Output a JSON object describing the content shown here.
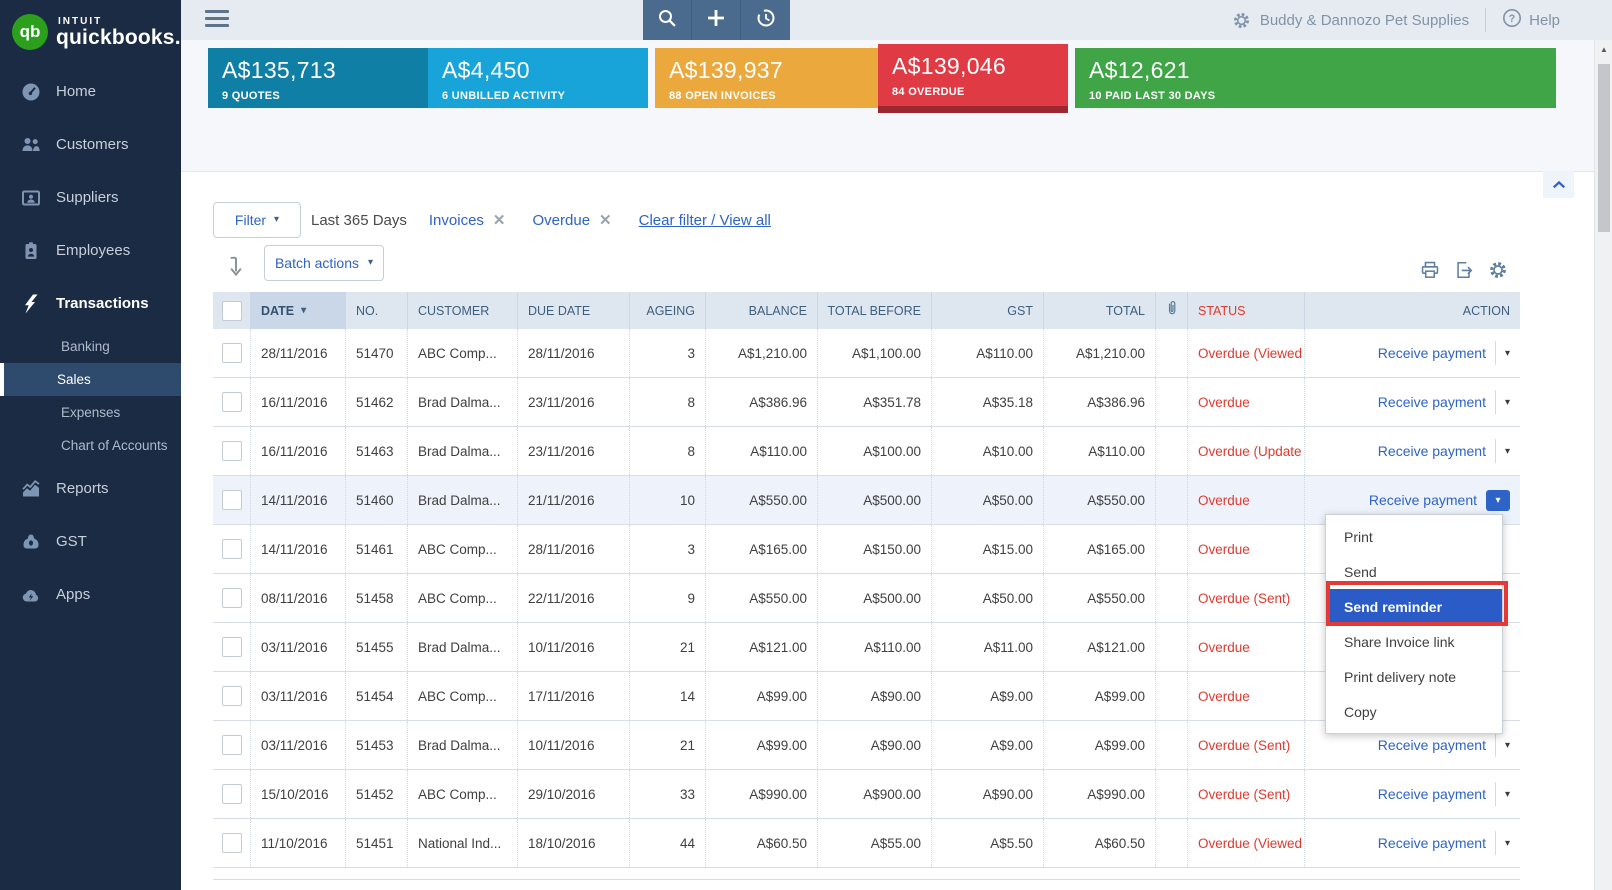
{
  "brand": {
    "intuit": "INTUIT",
    "name": "quickbooks.",
    "monogram": "qb"
  },
  "topbar": {
    "company": "Buddy & Dannozo Pet Supplies",
    "help_label": "Help"
  },
  "sidebar": {
    "items": [
      {
        "label": "Home",
        "icon": "gauge-icon",
        "active": false
      },
      {
        "label": "Customers",
        "icon": "customers-icon",
        "active": false
      },
      {
        "label": "Suppliers",
        "icon": "suppliers-icon",
        "active": false
      },
      {
        "label": "Employees",
        "icon": "employees-icon",
        "active": false
      },
      {
        "label": "Transactions",
        "icon": "transactions-icon",
        "active": true,
        "children": [
          {
            "label": "Banking",
            "active": false
          },
          {
            "label": "Sales",
            "active": true
          },
          {
            "label": "Expenses",
            "active": false
          },
          {
            "label": "Chart of Accounts",
            "active": false
          }
        ]
      },
      {
        "label": "Reports",
        "icon": "reports-icon",
        "active": false
      },
      {
        "label": "GST",
        "icon": "gst-icon",
        "active": false
      },
      {
        "label": "Apps",
        "icon": "apps-icon",
        "active": false
      }
    ]
  },
  "money_bar": [
    {
      "amount": "A$135,713",
      "label": "9 QUOTES",
      "color": "#0F7FA5",
      "raised": false
    },
    {
      "amount": "A$4,450",
      "label": "6 UNBILLED ACTIVITY",
      "color": "#18A4D9",
      "raised": false
    },
    {
      "amount": "A$139,937",
      "label": "88 OPEN INVOICES",
      "color": "#EBA83C",
      "raised": false
    },
    {
      "amount": "A$139,046",
      "label": "84 OVERDUE",
      "color": "#E03B44",
      "accent": "#9C2730",
      "raised": true
    },
    {
      "amount": "A$12,621",
      "label": "10 PAID LAST 30 DAYS",
      "color": "#3FA546",
      "raised": false
    }
  ],
  "filter_bar": {
    "filter_label": "Filter",
    "range": "Last 365 Days",
    "chips": [
      "Invoices",
      "Overdue"
    ],
    "clear_link": "Clear filter / View all",
    "batch_label": "Batch actions"
  },
  "table": {
    "columns": [
      "DATE",
      "NO.",
      "CUSTOMER",
      "DUE DATE",
      "AGEING",
      "BALANCE",
      "TOTAL BEFORE",
      "GST",
      "TOTAL",
      "STATUS",
      "ACTION"
    ],
    "sorted_column": "DATE",
    "action_label": "Receive payment",
    "rows": [
      {
        "date": "28/11/2016",
        "no": "51470",
        "customer": "ABC Comp...",
        "due": "28/11/2016",
        "ageing": "3",
        "balance": "A$1,210.00",
        "before": "A$1,100.00",
        "gst": "A$110.00",
        "total": "A$1,210.00",
        "status": "Overdue (Viewed",
        "action": true,
        "open": false
      },
      {
        "date": "16/11/2016",
        "no": "51462",
        "customer": "Brad Dalma...",
        "due": "23/11/2016",
        "ageing": "8",
        "balance": "A$386.96",
        "before": "A$351.78",
        "gst": "A$35.18",
        "total": "A$386.96",
        "status": "Overdue",
        "action": true,
        "open": false
      },
      {
        "date": "16/11/2016",
        "no": "51463",
        "customer": "Brad Dalma...",
        "due": "23/11/2016",
        "ageing": "8",
        "balance": "A$110.00",
        "before": "A$100.00",
        "gst": "A$10.00",
        "total": "A$110.00",
        "status": "Overdue (Update",
        "action": true,
        "open": false
      },
      {
        "date": "14/11/2016",
        "no": "51460",
        "customer": "Brad Dalma...",
        "due": "21/11/2016",
        "ageing": "10",
        "balance": "A$550.00",
        "before": "A$500.00",
        "gst": "A$50.00",
        "total": "A$550.00",
        "status": "Overdue",
        "action": true,
        "open": true
      },
      {
        "date": "14/11/2016",
        "no": "51461",
        "customer": "ABC Comp...",
        "due": "28/11/2016",
        "ageing": "3",
        "balance": "A$165.00",
        "before": "A$150.00",
        "gst": "A$15.00",
        "total": "A$165.00",
        "status": "Overdue",
        "action": false,
        "open": false
      },
      {
        "date": "08/11/2016",
        "no": "51458",
        "customer": "ABC Comp...",
        "due": "22/11/2016",
        "ageing": "9",
        "balance": "A$550.00",
        "before": "A$500.00",
        "gst": "A$50.00",
        "total": "A$550.00",
        "status": "Overdue (Sent)",
        "action": false,
        "open": false
      },
      {
        "date": "03/11/2016",
        "no": "51455",
        "customer": "Brad Dalma...",
        "due": "10/11/2016",
        "ageing": "21",
        "balance": "A$121.00",
        "before": "A$110.00",
        "gst": "A$11.00",
        "total": "A$121.00",
        "status": "Overdue",
        "action": false,
        "open": false
      },
      {
        "date": "03/11/2016",
        "no": "51454",
        "customer": "ABC Comp...",
        "due": "17/11/2016",
        "ageing": "14",
        "balance": "A$99.00",
        "before": "A$90.00",
        "gst": "A$9.00",
        "total": "A$99.00",
        "status": "Overdue",
        "action": false,
        "open": false
      },
      {
        "date": "03/11/2016",
        "no": "51453",
        "customer": "Brad Dalma...",
        "due": "10/11/2016",
        "ageing": "21",
        "balance": "A$99.00",
        "before": "A$90.00",
        "gst": "A$9.00",
        "total": "A$99.00",
        "status": "Overdue (Sent)",
        "action": true,
        "open": false
      },
      {
        "date": "15/10/2016",
        "no": "51452",
        "customer": "ABC Comp...",
        "due": "29/10/2016",
        "ageing": "33",
        "balance": "A$990.00",
        "before": "A$900.00",
        "gst": "A$90.00",
        "total": "A$990.00",
        "status": "Overdue (Sent)",
        "action": true,
        "open": false
      },
      {
        "date": "11/10/2016",
        "no": "51451",
        "customer": "National Ind...",
        "due": "18/10/2016",
        "ageing": "44",
        "balance": "A$60.50",
        "before": "A$55.00",
        "gst": "A$5.50",
        "total": "A$60.50",
        "status": "Overdue (Viewed",
        "action": true,
        "open": false
      }
    ]
  },
  "menu": {
    "items": [
      "Print",
      "Send",
      "Send reminder",
      "Share Invoice link",
      "Print delivery note",
      "Copy"
    ],
    "highlighted": "Send reminder",
    "highlight_color": "#2A5BC7",
    "annotation_color": "#E53935"
  }
}
